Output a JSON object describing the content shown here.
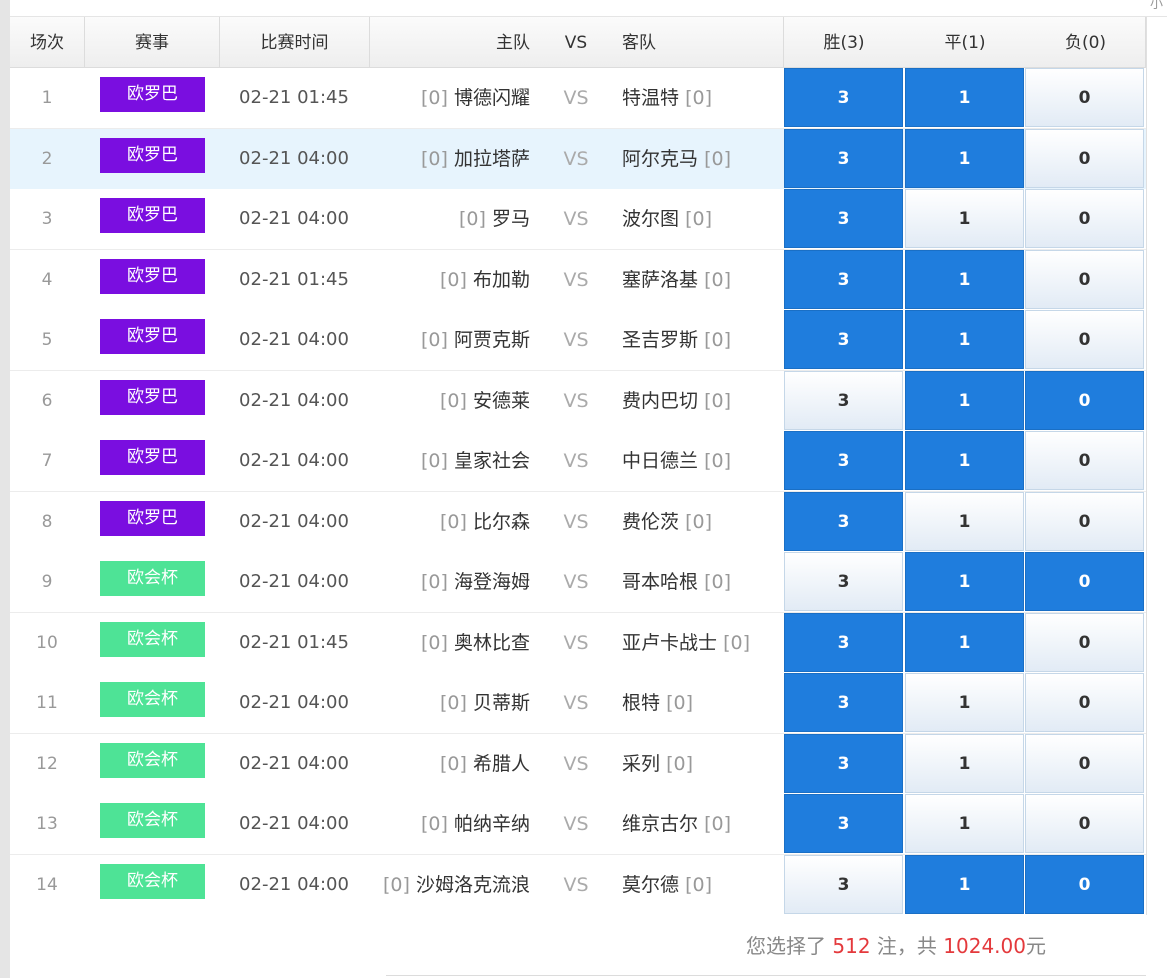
{
  "top_fragment": "小",
  "columns": {
    "index": "场次",
    "league": "赛事",
    "time": "比赛时间",
    "home": "主队",
    "vs": "VS",
    "away": "客队",
    "win": "胜(3)",
    "draw": "平(1)",
    "loss": "负(0)"
  },
  "colors": {
    "europa": "#7a0ee0",
    "conference": "#4ee396",
    "selected": "#1f7ddd"
  },
  "matches": [
    {
      "idx": "1",
      "league": "欧罗巴",
      "league_type": "europa",
      "time": "02-21 01:45",
      "home_rank": "[0]",
      "home": "博德闪耀",
      "vs": "VS",
      "away": "特温特",
      "away_rank": "[0]",
      "win_label": "3",
      "draw_label": "1",
      "loss_label": "0",
      "win_selected": true,
      "draw_selected": true,
      "loss_selected": false,
      "highlighted": false
    },
    {
      "idx": "2",
      "league": "欧罗巴",
      "league_type": "europa",
      "time": "02-21 04:00",
      "home_rank": "[0]",
      "home": "加拉塔萨",
      "vs": "VS",
      "away": "阿尔克马",
      "away_rank": "[0]",
      "win_label": "3",
      "draw_label": "1",
      "loss_label": "0",
      "win_selected": true,
      "draw_selected": true,
      "loss_selected": false,
      "highlighted": true
    },
    {
      "idx": "3",
      "league": "欧罗巴",
      "league_type": "europa",
      "time": "02-21 04:00",
      "home_rank": "[0]",
      "home": "罗马",
      "vs": "VS",
      "away": "波尔图",
      "away_rank": "[0]",
      "win_label": "3",
      "draw_label": "1",
      "loss_label": "0",
      "win_selected": true,
      "draw_selected": false,
      "loss_selected": false,
      "highlighted": false
    },
    {
      "idx": "4",
      "league": "欧罗巴",
      "league_type": "europa",
      "time": "02-21 01:45",
      "home_rank": "[0]",
      "home": "布加勒",
      "vs": "VS",
      "away": "塞萨洛基",
      "away_rank": "[0]",
      "win_label": "3",
      "draw_label": "1",
      "loss_label": "0",
      "win_selected": true,
      "draw_selected": true,
      "loss_selected": false,
      "highlighted": false
    },
    {
      "idx": "5",
      "league": "欧罗巴",
      "league_type": "europa",
      "time": "02-21 04:00",
      "home_rank": "[0]",
      "home": "阿贾克斯",
      "vs": "VS",
      "away": "圣吉罗斯",
      "away_rank": "[0]",
      "win_label": "3",
      "draw_label": "1",
      "loss_label": "0",
      "win_selected": true,
      "draw_selected": true,
      "loss_selected": false,
      "highlighted": false
    },
    {
      "idx": "6",
      "league": "欧罗巴",
      "league_type": "europa",
      "time": "02-21 04:00",
      "home_rank": "[0]",
      "home": "安德莱",
      "vs": "VS",
      "away": "费内巴切",
      "away_rank": "[0]",
      "win_label": "3",
      "draw_label": "1",
      "loss_label": "0",
      "win_selected": false,
      "draw_selected": true,
      "loss_selected": true,
      "highlighted": false
    },
    {
      "idx": "7",
      "league": "欧罗巴",
      "league_type": "europa",
      "time": "02-21 04:00",
      "home_rank": "[0]",
      "home": "皇家社会",
      "vs": "VS",
      "away": "中日德兰",
      "away_rank": "[0]",
      "win_label": "3",
      "draw_label": "1",
      "loss_label": "0",
      "win_selected": true,
      "draw_selected": true,
      "loss_selected": false,
      "highlighted": false
    },
    {
      "idx": "8",
      "league": "欧罗巴",
      "league_type": "europa",
      "time": "02-21 04:00",
      "home_rank": "[0]",
      "home": "比尔森",
      "vs": "VS",
      "away": "费伦茨",
      "away_rank": "[0]",
      "win_label": "3",
      "draw_label": "1",
      "loss_label": "0",
      "win_selected": true,
      "draw_selected": false,
      "loss_selected": false,
      "highlighted": false
    },
    {
      "idx": "9",
      "league": "欧会杯",
      "league_type": "conference",
      "time": "02-21 04:00",
      "home_rank": "[0]",
      "home": "海登海姆",
      "vs": "VS",
      "away": "哥本哈根",
      "away_rank": "[0]",
      "win_label": "3",
      "draw_label": "1",
      "loss_label": "0",
      "win_selected": false,
      "draw_selected": true,
      "loss_selected": true,
      "highlighted": false
    },
    {
      "idx": "10",
      "league": "欧会杯",
      "league_type": "conference",
      "time": "02-21 01:45",
      "home_rank": "[0]",
      "home": "奥林比查",
      "vs": "VS",
      "away": "亚卢卡战士",
      "away_rank": "[0]",
      "win_label": "3",
      "draw_label": "1",
      "loss_label": "0",
      "win_selected": true,
      "draw_selected": true,
      "loss_selected": false,
      "highlighted": false
    },
    {
      "idx": "11",
      "league": "欧会杯",
      "league_type": "conference",
      "time": "02-21 04:00",
      "home_rank": "[0]",
      "home": "贝蒂斯",
      "vs": "VS",
      "away": "根特",
      "away_rank": "[0]",
      "win_label": "3",
      "draw_label": "1",
      "loss_label": "0",
      "win_selected": true,
      "draw_selected": false,
      "loss_selected": false,
      "highlighted": false
    },
    {
      "idx": "12",
      "league": "欧会杯",
      "league_type": "conference",
      "time": "02-21 04:00",
      "home_rank": "[0]",
      "home": "希腊人",
      "vs": "VS",
      "away": "采列",
      "away_rank": "[0]",
      "win_label": "3",
      "draw_label": "1",
      "loss_label": "0",
      "win_selected": true,
      "draw_selected": false,
      "loss_selected": false,
      "highlighted": false
    },
    {
      "idx": "13",
      "league": "欧会杯",
      "league_type": "conference",
      "time": "02-21 04:00",
      "home_rank": "[0]",
      "home": "帕纳辛纳",
      "vs": "VS",
      "away": "维京古尔",
      "away_rank": "[0]",
      "win_label": "3",
      "draw_label": "1",
      "loss_label": "0",
      "win_selected": true,
      "draw_selected": false,
      "loss_selected": false,
      "highlighted": false
    },
    {
      "idx": "14",
      "league": "欧会杯",
      "league_type": "conference",
      "time": "02-21 04:00",
      "home_rank": "[0]",
      "home": "沙姆洛克流浪",
      "vs": "VS",
      "away": "莫尔德",
      "away_rank": "[0]",
      "win_label": "3",
      "draw_label": "1",
      "loss_label": "0",
      "win_selected": false,
      "draw_selected": true,
      "loss_selected": true,
      "highlighted": false
    }
  ],
  "summary": {
    "prefix": "您选择了",
    "bets": "512",
    "bets_unit": "注，共",
    "amount": "1024.00",
    "currency": "元"
  }
}
